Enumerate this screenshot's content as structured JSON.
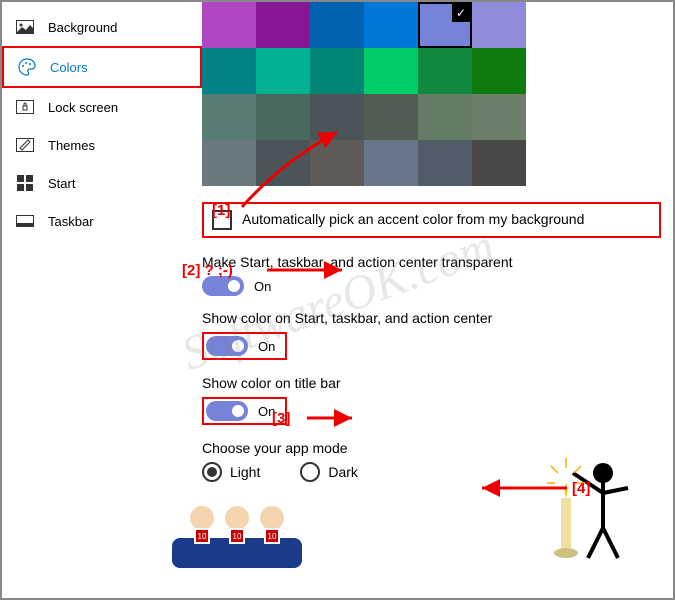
{
  "sidebar": {
    "items": [
      {
        "label": "Background",
        "icon": "image-icon"
      },
      {
        "label": "Colors",
        "icon": "palette-icon",
        "active": true
      },
      {
        "label": "Lock screen",
        "icon": "lock-icon"
      },
      {
        "label": "Themes",
        "icon": "brush-icon"
      },
      {
        "label": "Start",
        "icon": "start-icon"
      },
      {
        "label": "Taskbar",
        "icon": "taskbar-icon"
      }
    ]
  },
  "colors": {
    "swatches": [
      "#b146c2",
      "#881798",
      "#0063b1",
      "#0078d7",
      "#7683d8",
      "#8e8cd8",
      "#038387",
      "#00b294",
      "#018574",
      "#00cc6a",
      "#10893e",
      "#107c10",
      "#567c73",
      "#486860",
      "#4a5459",
      "#525e54",
      "#647c64",
      "#6b7f6b",
      "#69797e",
      "#4a5459",
      "#5d5a58",
      "#68768a",
      "#515c6b",
      "#4a4846"
    ],
    "selected_index": 4
  },
  "auto_pick": {
    "label": "Automatically pick an accent color from my background",
    "checked": false
  },
  "settings": {
    "transparent": {
      "label": "Make Start, taskbar, and action center transparent",
      "state": "On"
    },
    "show_color_start": {
      "label": "Show color on Start, taskbar, and action center",
      "state": "On"
    },
    "show_color_title": {
      "label": "Show color on title bar",
      "state": "On"
    }
  },
  "app_mode": {
    "label": "Choose your app mode",
    "options": [
      "Light",
      "Dark"
    ],
    "selected": "Light"
  },
  "annotations": {
    "a1": "[1]",
    "a2": "[2] ? ;-)",
    "a3": "[3]",
    "a4": "[4]"
  },
  "watermark": "SoftwareOK.com"
}
